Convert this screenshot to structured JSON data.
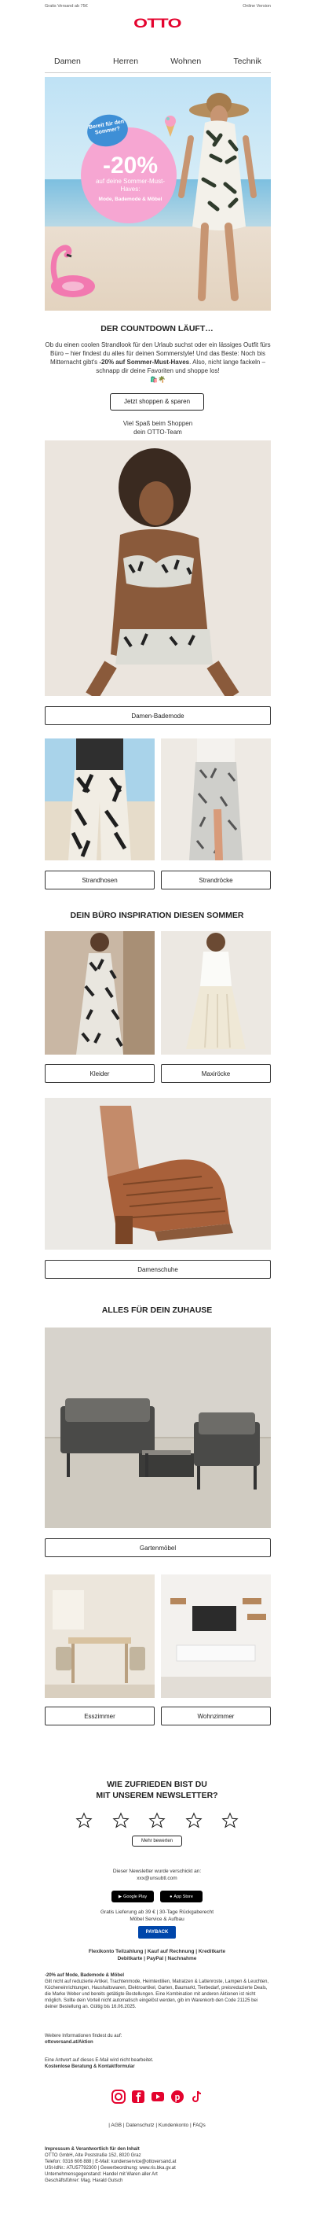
{
  "topbar": {
    "left": "Gratis Versand ab 75€",
    "right": "Online Version"
  },
  "brand": {
    "logo": "OTTO",
    "color": "#e4032e"
  },
  "nav": {
    "items": [
      "Damen",
      "Herren",
      "Wohnen",
      "Technik"
    ]
  },
  "hero": {
    "badge": "Bereit für den Sommer?",
    "percent": "-20%",
    "subtitle": "auf deine Sommer-Must-Haves:",
    "categories": "Mode, Bademode & Möbel"
  },
  "countdown": {
    "title": "DER COUNTDOWN LÄUFT…",
    "body_intro": "Ob du einen coolen Strandlook für den Urlaub suchst oder ein lässiges Outfit fürs Büro – hier findest du alles für deinen Sommerstyle! Und das Beste: Noch bis Mitternacht gibt's ",
    "body_bold": "-20% auf Sommer-Must-Haves",
    "body_end": ". Also, nicht lange fackeln – schnapp dir deine Favoriten und shoppe los!",
    "emoji": "🛍️🌴",
    "button": "Jetzt shoppen & sparen",
    "signoff_1": "Viel Spaß beim Shoppen",
    "signoff_2": "dein OTTO-Team"
  },
  "swim": {
    "label_main": "Damen-Bademode",
    "label_left": "Strandhosen",
    "label_right": "Strandröcke"
  },
  "office": {
    "title": "DEIN BÜRO INSPIRATION DIESEN SOMMER",
    "label_left": "Kleider",
    "label_right": "Maxiröcke",
    "label_shoes": "Damenschuhe"
  },
  "home": {
    "title": "ALLES FÜR DEIN ZUHAUSE",
    "label_garden": "Gartenmöbel",
    "label_left": "Esszimmer",
    "label_right": "Wohnzimmer"
  },
  "survey": {
    "title_1": "WIE ZUFRIEDEN BIST DU",
    "title_2": "MIT UNSEREM NEWSLETTER?",
    "rating": 0,
    "stars_total": 5,
    "more_button": "Mehr bewerten"
  },
  "footer": {
    "sent_to_1": "Dieser Newsletter wurde verschickt an:",
    "sent_to_2": "xxx@unsubtl.com",
    "google_play": "Google Play",
    "app_store": "App Store",
    "delivery_1": "Gratis Lieferung ab 39 € | 30-Tage Rückgaberecht",
    "delivery_2": "Möbel Service & Aufbau",
    "payback": "PAYBACK",
    "payment_1": "Flexikonto Teilzahlung | Kauf auf Rechnung | Kreditkarte",
    "payment_2": "Debitkarte | PayPal | Nachnahme",
    "legal_title": "-20% auf Mode, Bademode & Möbel",
    "legal_body": "Gilt nicht auf reduzierte Artikel, Trachtenmode, Heimtextilien, Matratzen & Lattenroste, Lampen & Leuchten, Kücheneinrichtungen, Haushaltswaren, Elektroartikel, Garten, Baumarkt, Tierbedarf, preisreduzierte Deals, die Marke Weber und bereits getätigte Bestellungen. Eine Kombination mit anderen Aktionen ist nicht möglich. Sollte dein Vorteil nicht automatisch eingelöst werden, gib im Warenkorb den Code 21125 bei deiner Bestellung an. Gültig bis 16.06.2025.",
    "more_info_1": "Weitere Informationen findest du auf:",
    "more_info_2": "ottoversand.at/Aktion",
    "reply_1": "Eine Antwort auf dieses E-Mail wird nicht bearbeitet.",
    "reply_2": "Kostenlose Beratung & Kontaktformular",
    "social_icons": [
      "instagram-icon",
      "facebook-icon",
      "youtube-icon",
      "pinterest-icon",
      "tiktok-icon"
    ],
    "links": "| AGB | Datenschutz | Kundenkonto | FAQs",
    "imprint_title": "Impressum & Verantwortlich für den Inhalt",
    "imprint_1": "OTTO GmbH, Alte Poststraße 152, 8020 Graz",
    "imprint_2": "Telefon: 0316 606 888 | E-Mail: kundenservice@ottoversand.at",
    "imprint_3": "USt-IdNr.: ATU57792300 | Gewerbeordnung: www.ris.bka.gv.at",
    "imprint_4": "Unternehmensgegenstand: Handel mit Waren aller Art",
    "imprint_5": "Geschäftsführer: Mag. Harald Gutsch"
  },
  "colors": {
    "accent": "#e4032e",
    "pink": "#f6a6d2",
    "payback_blue": "#0046aa"
  }
}
